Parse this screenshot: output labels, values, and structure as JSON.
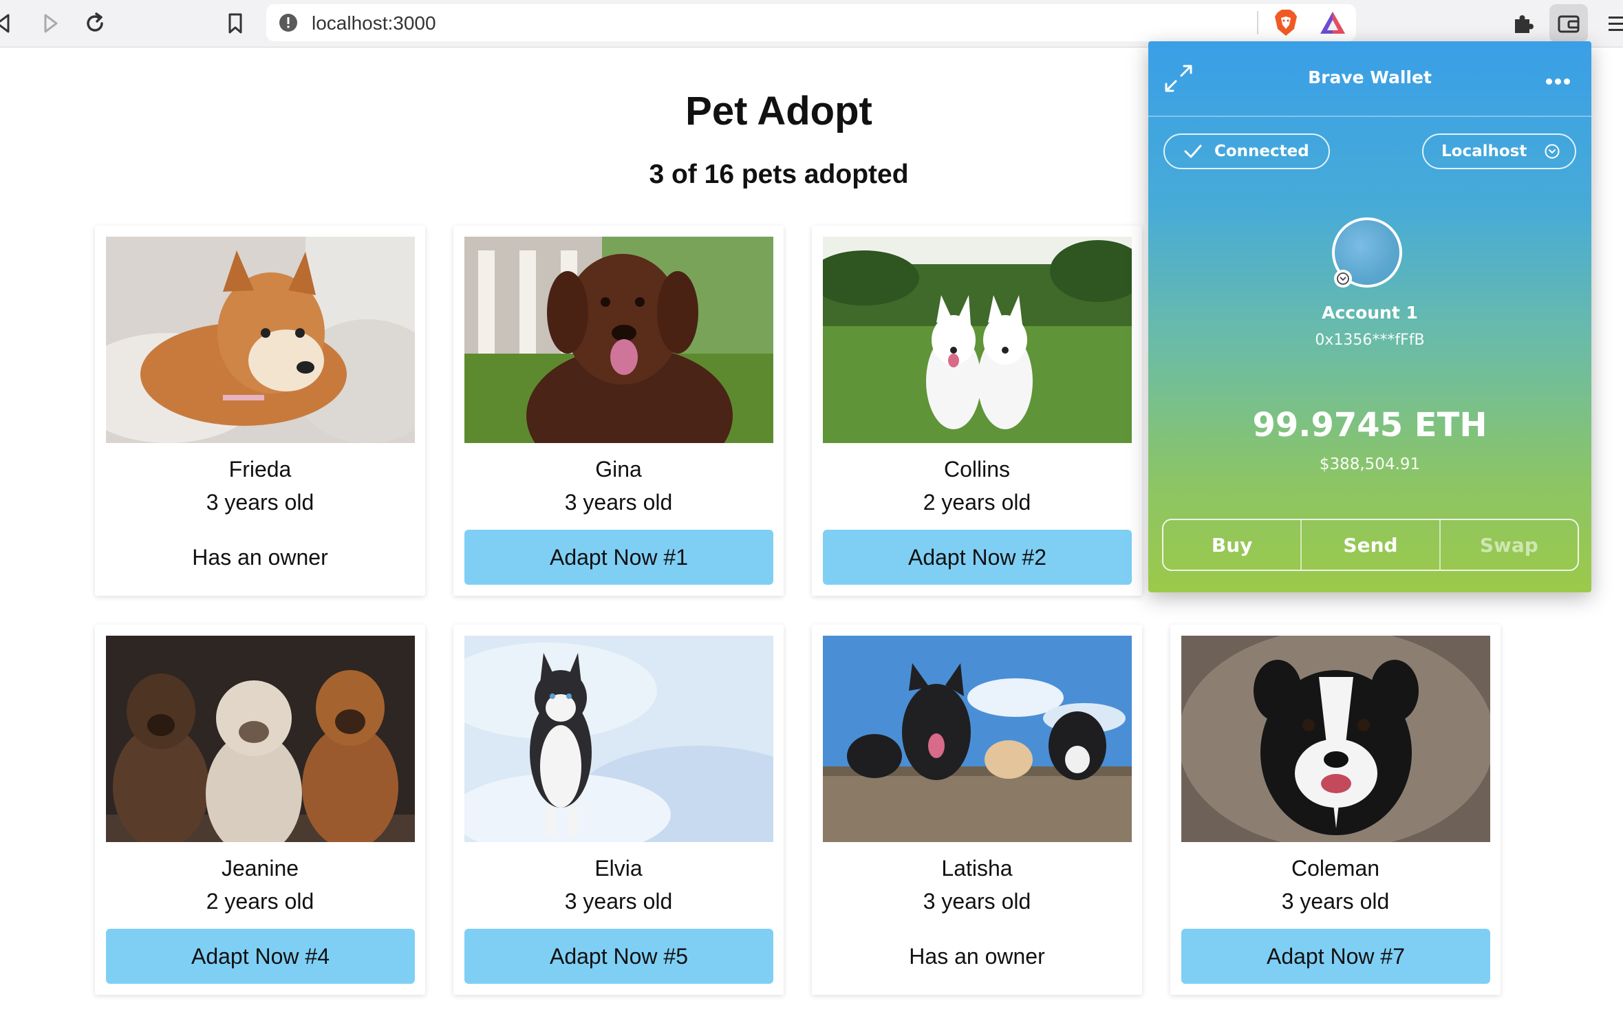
{
  "browser": {
    "url": "localhost:3000"
  },
  "page": {
    "title": "Pet Adopt",
    "subtitle": "3 of 16 pets adopted"
  },
  "pets": [
    {
      "name": "Frieda",
      "age": "3 years old",
      "status": "Has an owner",
      "button": ""
    },
    {
      "name": "Gina",
      "age": "3 years old",
      "status": "",
      "button": "Adapt Now #1"
    },
    {
      "name": "Collins",
      "age": "2 years old",
      "status": "",
      "button": "Adapt Now #2"
    },
    {
      "name": "Jeanine",
      "age": "2 years old",
      "status": "",
      "button": "Adapt Now #4"
    },
    {
      "name": "Elvia",
      "age": "3 years old",
      "status": "",
      "button": "Adapt Now #5"
    },
    {
      "name": "Latisha",
      "age": "3 years old",
      "status": "Has an owner",
      "button": ""
    },
    {
      "name": "Coleman",
      "age": "3 years old",
      "status": "",
      "button": "Adapt Now #7"
    }
  ],
  "wallet": {
    "title": "Brave Wallet",
    "connected": "Connected",
    "network": "Localhost",
    "account_name": "Account 1",
    "account_address": "0x1356***fFfB",
    "balance": "99.9745 ETH",
    "balance_usd": "$388,504.91",
    "buy": "Buy",
    "send": "Send",
    "swap": "Swap"
  },
  "colors": {
    "adopt_button": "#7fcff5",
    "wallet_top": "#3a9fe6",
    "wallet_bottom": "#9cc94a"
  }
}
